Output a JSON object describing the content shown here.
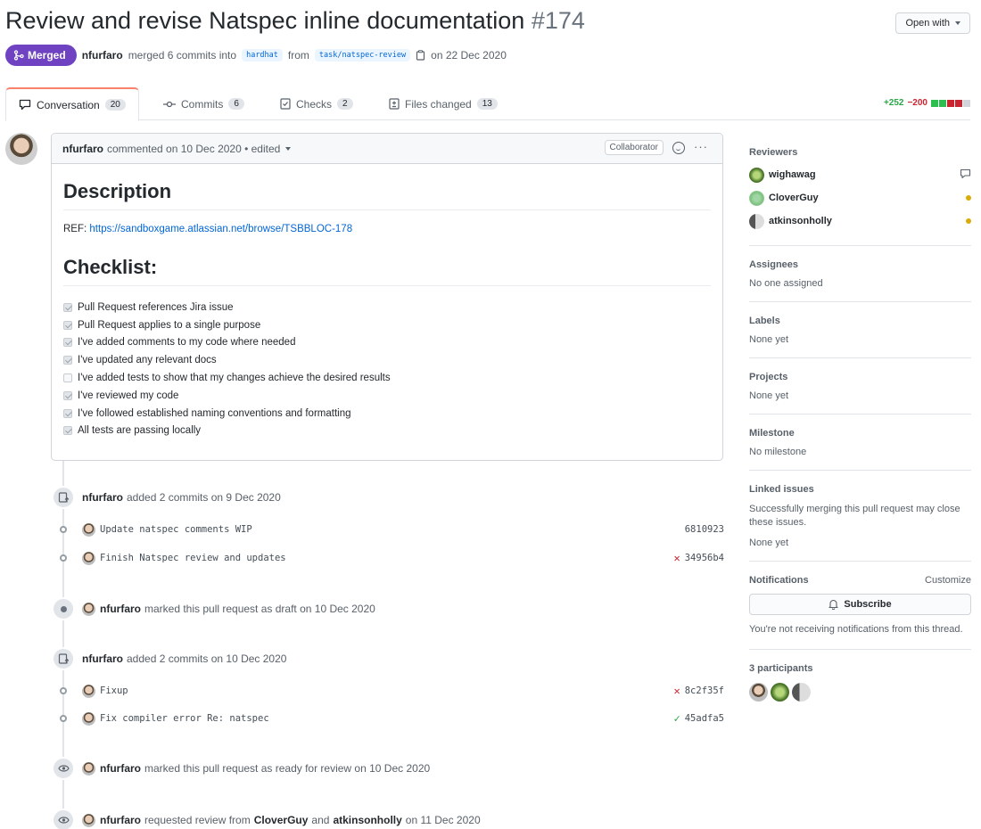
{
  "header": {
    "title": "Review and revise Natspec inline documentation",
    "number": "#174",
    "open_with": "Open with"
  },
  "meta": {
    "state": "Merged",
    "author": "nfurfaro",
    "text1": "merged 6 commits into",
    "base": "hardhat",
    "text2": "from",
    "head": "task/natspec-review",
    "date": "on 22 Dec 2020"
  },
  "tabs": [
    {
      "label": "Conversation",
      "count": "20"
    },
    {
      "label": "Commits",
      "count": "6"
    },
    {
      "label": "Checks",
      "count": "2"
    },
    {
      "label": "Files changed",
      "count": "13"
    }
  ],
  "diffstat": {
    "additions": "+252",
    "deletions": "−200"
  },
  "comment": {
    "author": "nfurfaro",
    "action": "commented on 10 Dec 2020 • edited",
    "role": "Collaborator",
    "heading1": "Description",
    "ref_label": "REF:",
    "ref_link": "https://sandboxgame.atlassian.net/browse/TSBBLOC-178",
    "heading2": "Checklist:",
    "checklist": [
      {
        "text": "Pull Request references Jira issue",
        "checked": true
      },
      {
        "text": "Pull Request applies to a single purpose",
        "checked": true
      },
      {
        "text": "I've added comments to my code where needed",
        "checked": true
      },
      {
        "text": "I've updated any relevant docs",
        "checked": true
      },
      {
        "text": "I've added tests to show that my changes achieve the desired results",
        "checked": false
      },
      {
        "text": "I've reviewed my code",
        "checked": true
      },
      {
        "text": "I've followed established naming conventions and formatting",
        "checked": true
      },
      {
        "text": "All tests are passing locally",
        "checked": true
      }
    ]
  },
  "timeline": {
    "ev1": {
      "actor": "nfurfaro",
      "text": "added 2 commits on 9 Dec 2020"
    },
    "c1": {
      "message": "Update natspec comments WIP",
      "sha": "6810923"
    },
    "c2": {
      "message": "Finish Natspec review and updates",
      "sha": "34956b4"
    },
    "ev2": {
      "actor": "nfurfaro",
      "text": "marked this pull request as draft on 10 Dec 2020"
    },
    "ev3": {
      "actor": "nfurfaro",
      "text": "added 2 commits on 10 Dec 2020"
    },
    "c3": {
      "message": "Fixup",
      "sha": "8c2f35f"
    },
    "c4": {
      "message": "Fix compiler error Re: natspec",
      "sha": "45adfa5"
    },
    "ev4": {
      "actor": "nfurfaro",
      "text": "marked this pull request as ready for review on 10 Dec 2020"
    },
    "ev5": {
      "actor": "nfurfaro",
      "text1": "requested review from",
      "u1": "CloverGuy",
      "and": "and",
      "u2": "atkinsonholly",
      "text2": "on 11 Dec 2020"
    }
  },
  "sidebar": {
    "reviewers_title": "Reviewers",
    "reviewers": [
      "wighawag",
      "CloverGuy",
      "atkinsonholly"
    ],
    "assignees_title": "Assignees",
    "assignees_value": "No one assigned",
    "labels_title": "Labels",
    "labels_value": "None yet",
    "projects_title": "Projects",
    "projects_value": "None yet",
    "milestone_title": "Milestone",
    "milestone_value": "No milestone",
    "linked_title": "Linked issues",
    "linked_desc": "Successfully merging this pull request may close these issues.",
    "linked_value": "None yet",
    "notifications_title": "Notifications",
    "customize": "Customize",
    "subscribe": "Subscribe",
    "notif_desc": "You're not receiving notifications from this thread.",
    "participants": "3 participants"
  }
}
